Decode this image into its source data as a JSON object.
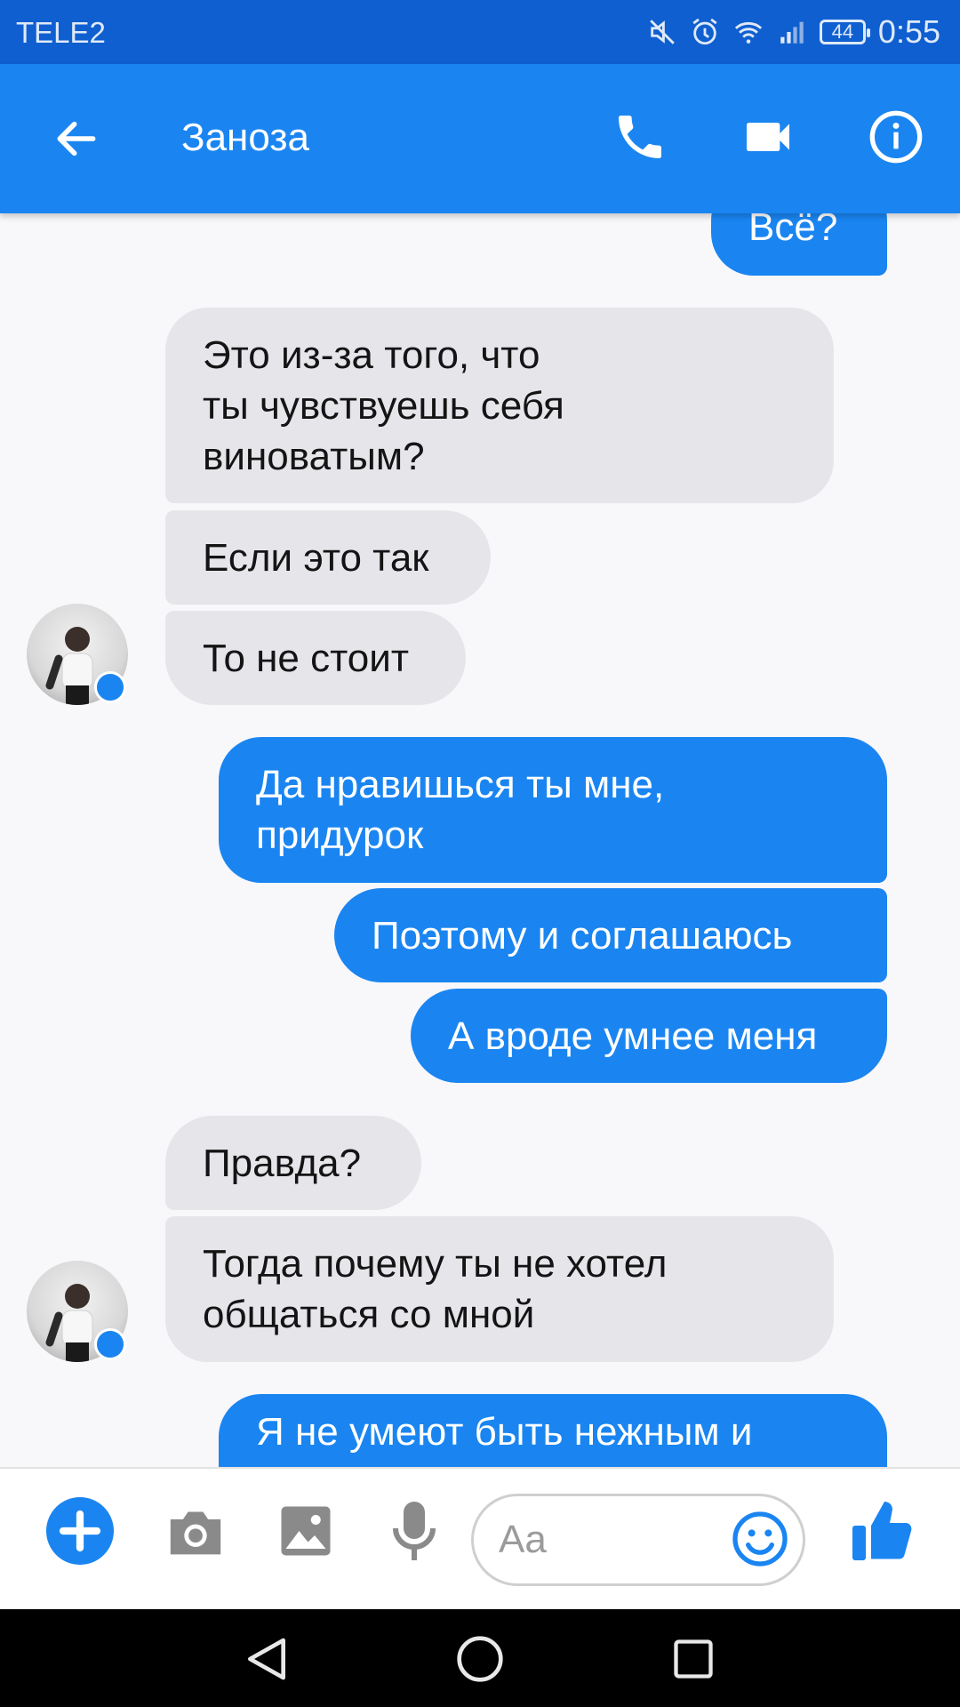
{
  "status": {
    "carrier": "TELE2",
    "battery": "44",
    "time": "0:55"
  },
  "header": {
    "title": "Заноза"
  },
  "messages": [
    {
      "side": "out",
      "lines": [
        "Всё?"
      ]
    },
    {
      "side": "in",
      "lines": [
        "Это из-за того, что",
        "ты чувствуешь себя",
        "виноватым?"
      ]
    },
    {
      "side": "in",
      "lines": [
        "Если это так"
      ]
    },
    {
      "side": "in",
      "lines": [
        "То не стоит"
      ]
    },
    {
      "side": "out",
      "lines": [
        "Да нравишься ты мне,",
        "придурок"
      ]
    },
    {
      "side": "out",
      "lines": [
        "Поэтому и соглашаюсь"
      ]
    },
    {
      "side": "out",
      "lines": [
        "А вроде умнее меня"
      ]
    },
    {
      "side": "in",
      "lines": [
        "Правда?"
      ]
    },
    {
      "side": "in",
      "lines": [
        "Тогда почему ты не хотел",
        "общаться со мной"
      ]
    },
    {
      "side": "out",
      "lines": [
        "Я не умеют быть нежным и"
      ]
    }
  ],
  "composer": {
    "placeholder": "Aa"
  },
  "colors": {
    "accent": "#1a85f1",
    "statusbar": "#0f5fd0",
    "incoming_bubble": "#e6e5ea"
  },
  "icons": [
    "back-arrow-icon",
    "phone-icon",
    "video-camera-icon",
    "info-icon",
    "plus-icon",
    "camera-icon",
    "image-icon",
    "microphone-icon",
    "emoji-icon",
    "thumbs-up-icon",
    "nav-back-icon",
    "nav-home-icon",
    "nav-recents-icon",
    "muted-icon",
    "alarm-icon",
    "wifi-icon",
    "signal-icon"
  ]
}
